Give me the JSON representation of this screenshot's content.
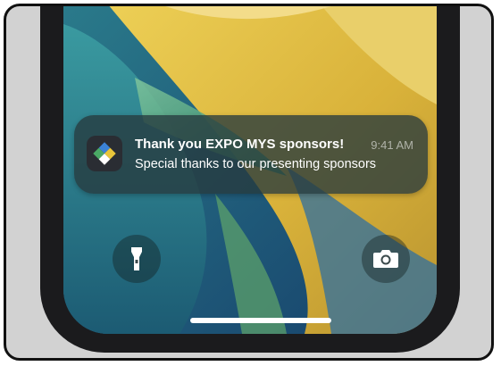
{
  "notification": {
    "app_icon": "expo-mys-diamond-icon",
    "title": "Thank you EXPO MYS sponsors!",
    "time": "9:41 AM",
    "body": "Special thanks to our presenting sponsors"
  },
  "lock_screen": {
    "flashlight_icon": "flashlight-icon",
    "camera_icon": "camera-icon"
  },
  "colors": {
    "wallpaper_blue": "#1f5d7f",
    "wallpaper_yellow": "#e6c74a",
    "wallpaper_green": "#3f9a73",
    "wallpaper_teal": "#2d8a8f"
  }
}
